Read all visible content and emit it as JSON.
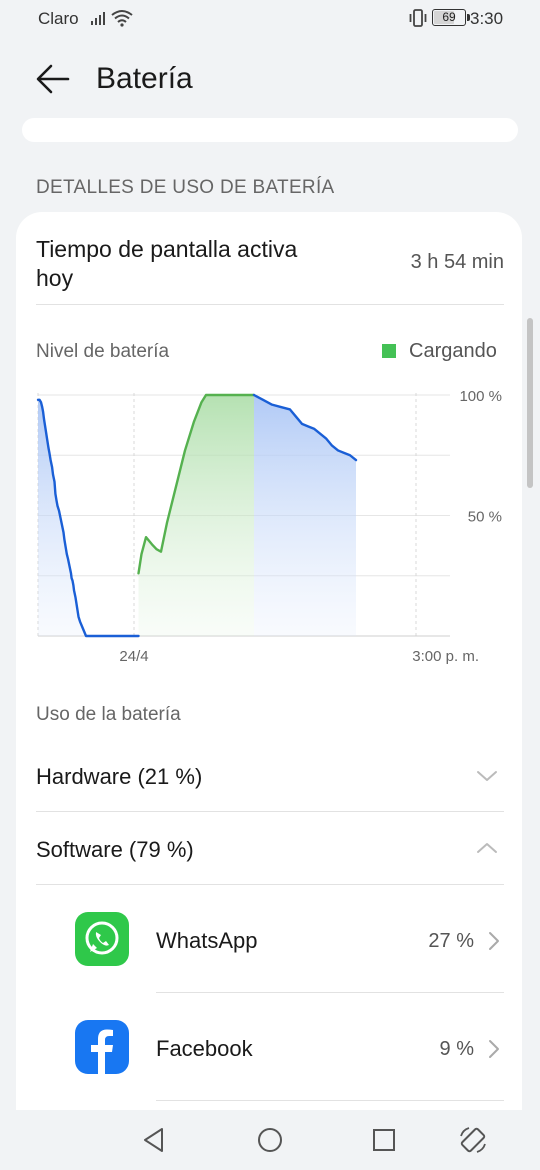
{
  "status_bar": {
    "carrier": "Claro",
    "battery_level": 69,
    "battery_text": "69",
    "time": "3:30"
  },
  "header": {
    "title": "Batería",
    "back_icon": "back-arrow-icon"
  },
  "section_header": "DETALLES DE USO DE BATERÍA",
  "screen_time": {
    "label": "Tiempo de pantalla activa hoy",
    "value": "3 h 54 min"
  },
  "chart_section": {
    "title": "Nivel de batería",
    "legend_label": "Cargando",
    "legend_color": "#44c155"
  },
  "chart_data": {
    "type": "area",
    "ylim": [
      0,
      100
    ],
    "y_ticks": [
      "100 %",
      "50 %"
    ],
    "x_ticks": [
      "24/4",
      "3:00 p. m."
    ],
    "colors": {
      "discharging": "#1a5fd6",
      "charging": "#55b14f"
    },
    "series": [
      {
        "name": "",
        "segment": "discharging",
        "points": [
          [
            0,
            98
          ],
          [
            0.05,
            98
          ],
          [
            0.1,
            97
          ],
          [
            0.14,
            95
          ],
          [
            0.17,
            93
          ],
          [
            0.2,
            90
          ],
          [
            0.25,
            86
          ],
          [
            0.3,
            82
          ],
          [
            0.35,
            78
          ],
          [
            0.38,
            76
          ],
          [
            0.42,
            73
          ],
          [
            0.47,
            70
          ],
          [
            0.5,
            67
          ],
          [
            0.55,
            64
          ],
          [
            0.58,
            59
          ],
          [
            0.62,
            56
          ],
          [
            0.65,
            54
          ],
          [
            0.7,
            52
          ],
          [
            0.75,
            49
          ],
          [
            0.8,
            46
          ],
          [
            0.85,
            43
          ],
          [
            0.88,
            40
          ],
          [
            0.92,
            37
          ],
          [
            0.96,
            34
          ],
          [
            1,
            32
          ],
          [
            1.05,
            29
          ],
          [
            1.1,
            26
          ],
          [
            1.12,
            24
          ],
          [
            1.15,
            23
          ],
          [
            1.18,
            21
          ],
          [
            1.2,
            19
          ],
          [
            1.25,
            16
          ],
          [
            1.3,
            12
          ],
          [
            1.35,
            8
          ],
          [
            1.4,
            6
          ],
          [
            1.5,
            3
          ],
          [
            1.6,
            0
          ],
          [
            1.8,
            -2
          ],
          [
            2.0,
            -4
          ],
          [
            2.2,
            -6
          ],
          [
            2.5,
            -8
          ],
          [
            2.8,
            -9
          ],
          [
            3.0,
            -10
          ],
          [
            3.2,
            -11
          ],
          [
            3.35,
            -12
          ]
        ]
      },
      {
        "name": "Cargando",
        "segment": "charging",
        "points": [
          [
            3.35,
            26
          ],
          [
            3.45,
            34
          ],
          [
            3.6,
            41
          ],
          [
            3.8,
            38
          ],
          [
            3.95,
            36
          ],
          [
            4.1,
            35
          ],
          [
            4.3,
            47
          ],
          [
            4.6,
            62
          ],
          [
            4.9,
            77
          ],
          [
            5.2,
            89
          ],
          [
            5.45,
            97
          ],
          [
            5.6,
            100
          ],
          [
            7.2,
            100
          ]
        ]
      },
      {
        "name": "",
        "segment": "discharging",
        "points": [
          [
            7.2,
            100
          ],
          [
            7.5,
            98
          ],
          [
            7.8,
            96
          ],
          [
            8.1,
            95
          ],
          [
            8.4,
            94
          ],
          [
            8.6,
            91
          ],
          [
            8.8,
            88
          ],
          [
            9.0,
            87
          ],
          [
            9.2,
            86
          ],
          [
            9.4,
            84
          ],
          [
            9.6,
            82
          ],
          [
            9.8,
            79
          ],
          [
            10.0,
            77
          ],
          [
            10.2,
            76
          ],
          [
            10.4,
            75
          ],
          [
            10.6,
            73
          ]
        ]
      }
    ]
  },
  "usage": {
    "title": "Uso de la batería",
    "hardware_label": "Hardware (21 %)",
    "software_label": "Software (79 %)",
    "apps": [
      {
        "name": "WhatsApp",
        "percent": "27 %",
        "icon": "whatsapp-icon",
        "color": "#2fc84a"
      },
      {
        "name": "Facebook",
        "percent": "9 %",
        "icon": "facebook-icon",
        "color": "#1877f2"
      }
    ]
  },
  "navbar": {
    "back": "nav-back-icon",
    "home": "nav-home-icon",
    "recents": "nav-recents-icon",
    "rotate": "rotate-icon"
  }
}
